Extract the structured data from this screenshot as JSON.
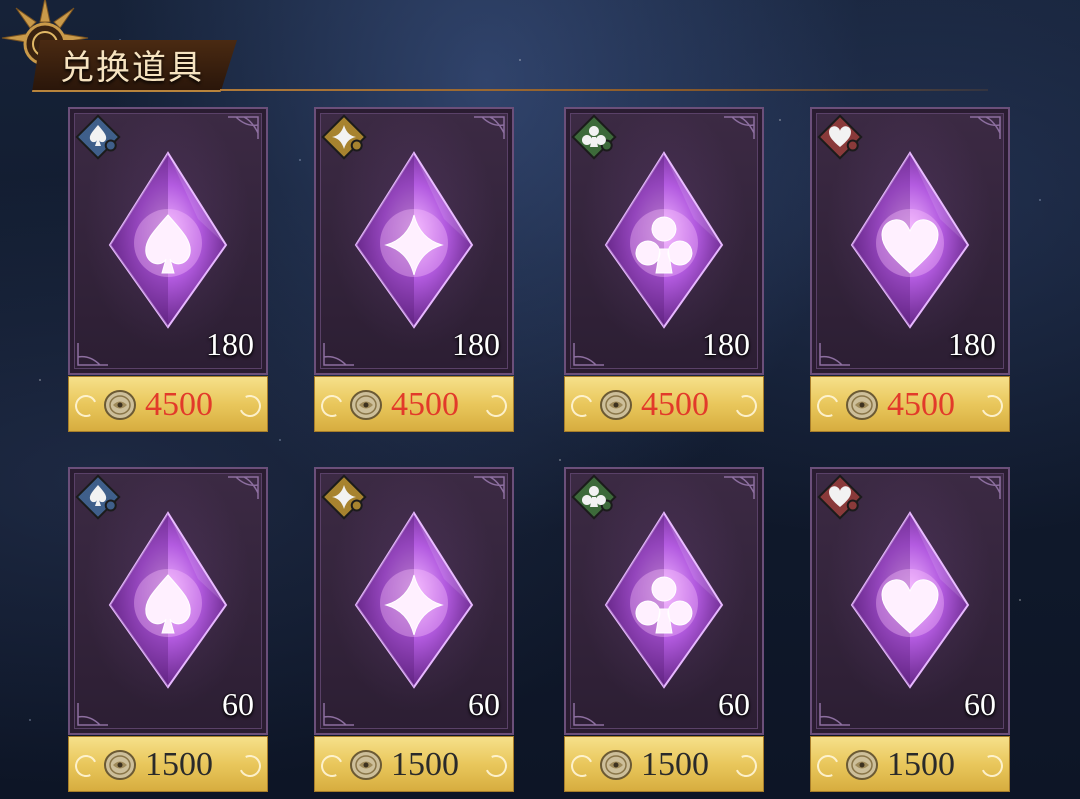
{
  "header": {
    "title": "兑换道具",
    "icon": "sun-emblem-icon"
  },
  "colors": {
    "price_expensive": "#e23a2a",
    "price_normal": "#2a2a2a",
    "crystal": "#b35be0",
    "spade_badge": "#3f5f8a",
    "diamond_badge": "#a7832f",
    "club_badge": "#3d6a3a",
    "heart_badge": "#8a3a3a"
  },
  "items": [
    {
      "suit": "spade",
      "icon": "spade-crystal-icon",
      "quantity": "180",
      "price": "4500",
      "expensive": true
    },
    {
      "suit": "diamond",
      "icon": "diamond-crystal-icon",
      "quantity": "180",
      "price": "4500",
      "expensive": true
    },
    {
      "suit": "club",
      "icon": "club-crystal-icon",
      "quantity": "180",
      "price": "4500",
      "expensive": true
    },
    {
      "suit": "heart",
      "icon": "heart-crystal-icon",
      "quantity": "180",
      "price": "4500",
      "expensive": true
    },
    {
      "suit": "spade",
      "icon": "spade-crystal-icon",
      "quantity": "60",
      "price": "1500",
      "expensive": false
    },
    {
      "suit": "diamond",
      "icon": "diamond-crystal-icon",
      "quantity": "60",
      "price": "1500",
      "expensive": false
    },
    {
      "suit": "club",
      "icon": "club-crystal-icon",
      "quantity": "60",
      "price": "1500",
      "expensive": false
    },
    {
      "suit": "heart",
      "icon": "heart-crystal-icon",
      "quantity": "60",
      "price": "1500",
      "expensive": false
    }
  ]
}
